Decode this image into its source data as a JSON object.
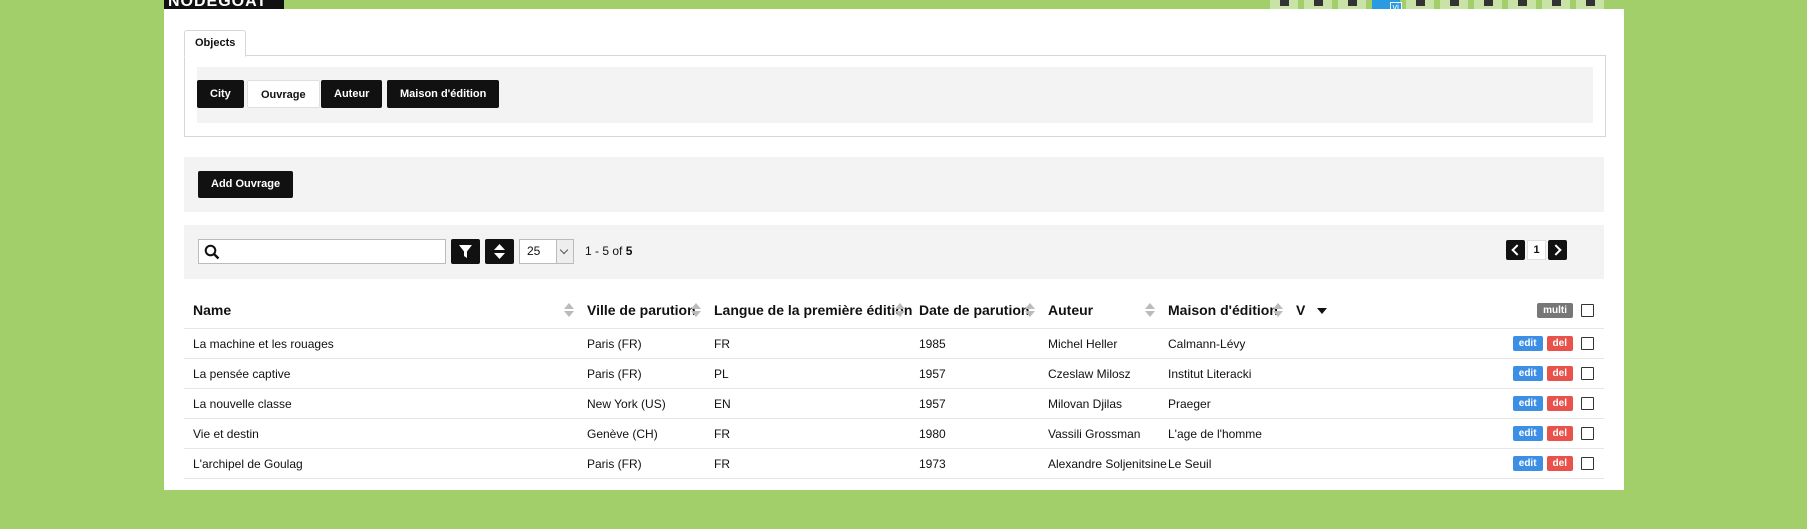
{
  "app": {
    "logo": "NODEGOAT"
  },
  "colors": {
    "background": "#a3cf6a",
    "edit": "#3d8fe6",
    "del": "#e8524a",
    "primary_button": "#111111"
  },
  "top_icons": [
    "eye-icon",
    "search-icon",
    "list-icon",
    "translate-icon",
    "box-icon",
    "download-icon",
    "edit-icon",
    "download-icon",
    "close-icon",
    "users-icon"
  ],
  "tabs": {
    "objects": "Objects"
  },
  "types": [
    "City",
    "Ouvrage",
    "Auteur",
    "Maison d'édition"
  ],
  "active_type": "Ouvrage",
  "add_button": "Add Ouvrage",
  "search": {
    "value": "",
    "placeholder": ""
  },
  "page_size": "25",
  "range": {
    "prefix": "1 - 5 of ",
    "total": "5"
  },
  "pagination": {
    "current": "1"
  },
  "table": {
    "columns": [
      "Name",
      "Ville de parution",
      "Langue de la première édition",
      "Date de parution",
      "Auteur",
      "Maison d'édition",
      "V"
    ],
    "multi_label": "multi",
    "edit_label": "edit",
    "del_label": "del",
    "rows": [
      [
        "La machine et les rouages",
        "Paris (FR)",
        "FR",
        "1985",
        "Michel Heller",
        "Calmann-Lévy"
      ],
      [
        "La pensée captive",
        "Paris (FR)",
        "PL",
        "1957",
        "Czeslaw Milosz",
        "Institut Literacki"
      ],
      [
        "La nouvelle classe",
        "New York (US)",
        "EN",
        "1957",
        "Milovan Djilas",
        "Praeger"
      ],
      [
        "Vie et destin",
        "Genève (CH)",
        "FR",
        "1980",
        "Vassili Grossman",
        "L'age de l'homme"
      ],
      [
        "L'archipel de Goulag",
        "Paris (FR)",
        "FR",
        "1973",
        "Alexandre Soljenitsine",
        "Le Seuil"
      ]
    ]
  }
}
